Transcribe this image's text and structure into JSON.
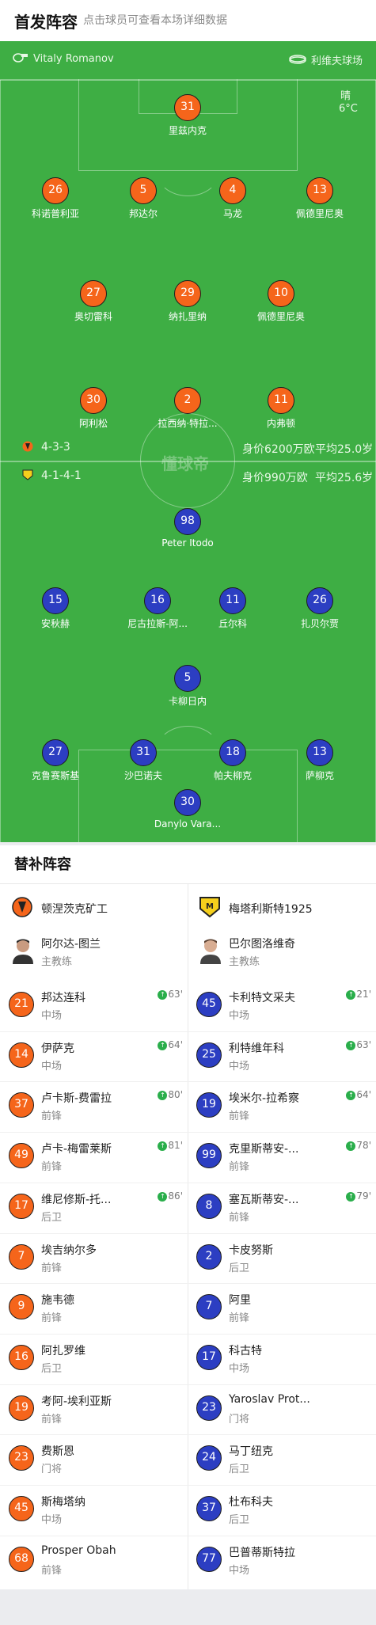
{
  "header": {
    "title": "首发阵容",
    "subtitle": "点击球员可查看本场详细数据"
  },
  "match": {
    "referee": "Vitaly Romanov",
    "stadium": "利维夫球场",
    "weather": "晴",
    "temperature": "6°C",
    "watermark": "懂球帝"
  },
  "home": {
    "formation": "4-3-3",
    "value": "身价6200万欧",
    "age": "平均25.0岁"
  },
  "away": {
    "formation": "4-1-4-1",
    "value": "身价990万欧",
    "age": "平均25.6岁"
  },
  "home_players": [
    {
      "num": "31",
      "name": "里兹内克"
    },
    {
      "num": "26",
      "name": "科诺普利亚"
    },
    {
      "num": "5",
      "name": "邦达尔",
      "card": "yellow",
      "captain": true
    },
    {
      "num": "4",
      "name": "马龙",
      "card": "yellow"
    },
    {
      "num": "13",
      "name": "佩德里尼奥"
    },
    {
      "num": "27",
      "name": "奥切雷科",
      "card": "yellow"
    },
    {
      "num": "29",
      "name": "纳扎里纳",
      "sub_out": "63'"
    },
    {
      "num": "10",
      "name": "佩德里尼奥",
      "sub_out": "64'",
      "goal": true
    },
    {
      "num": "30",
      "name": "阿利松",
      "sub_out": "86'"
    },
    {
      "num": "2",
      "name": "拉西纳·特拉...",
      "sub_out": "81'"
    },
    {
      "num": "11",
      "name": "内弗顿",
      "sub_out": "80'"
    }
  ],
  "away_players": [
    {
      "num": "98",
      "name": "Peter Itodo",
      "sub_out": "78'"
    },
    {
      "num": "15",
      "name": "安秋赫",
      "sub_out": "79'"
    },
    {
      "num": "16",
      "name": "尼古拉斯-阿...",
      "sub_out": "63'"
    },
    {
      "num": "11",
      "name": "丘尔科",
      "sub_out": "21'"
    },
    {
      "num": "26",
      "name": "扎贝尔贾",
      "sub_out": "64'"
    },
    {
      "num": "5",
      "name": "卡柳日内",
      "card": "yellow",
      "captain": true
    },
    {
      "num": "27",
      "name": "克鲁赛斯基"
    },
    {
      "num": "31",
      "name": "沙巴诺夫",
      "card": "yellow"
    },
    {
      "num": "18",
      "name": "帕夫柳克"
    },
    {
      "num": "13",
      "name": "萨柳克",
      "card": "yellow"
    },
    {
      "num": "30",
      "name": "Danylo Vara...",
      "card": "yellow"
    }
  ],
  "subs": {
    "title": "替补阵容",
    "home_team": "顿涅茨克矿工",
    "away_team": "梅塔利斯特1925",
    "home_coach": {
      "name": "阿尔达-图兰",
      "role": "主教练"
    },
    "away_coach": {
      "name": "巴尔图洛维奇",
      "role": "主教练"
    },
    "home": [
      {
        "num": "21",
        "name": "邦达连科",
        "pos": "中场",
        "sub": "63'"
      },
      {
        "num": "14",
        "name": "伊萨克",
        "pos": "中场",
        "sub": "64'"
      },
      {
        "num": "37",
        "name": "卢卡斯-费雷拉",
        "pos": "前锋",
        "sub": "80'"
      },
      {
        "num": "49",
        "name": "卢卡-梅雷莱斯",
        "pos": "前锋",
        "sub": "81'"
      },
      {
        "num": "17",
        "name": "维尼修斯-托...",
        "pos": "后卫",
        "sub": "86'"
      },
      {
        "num": "7",
        "name": "埃吉纳尔多",
        "pos": "前锋"
      },
      {
        "num": "9",
        "name": "施韦德",
        "pos": "前锋"
      },
      {
        "num": "16",
        "name": "阿扎罗维",
        "pos": "后卫"
      },
      {
        "num": "19",
        "name": "考阿-埃利亚斯",
        "pos": "前锋"
      },
      {
        "num": "23",
        "name": "费斯恩",
        "pos": "门将"
      },
      {
        "num": "45",
        "name": "斯梅塔纳",
        "pos": "中场"
      },
      {
        "num": "68",
        "name": "Prosper Obah",
        "pos": "前锋"
      }
    ],
    "away": [
      {
        "num": "45",
        "name": "卡利特文采夫",
        "pos": "中场",
        "sub": "21'"
      },
      {
        "num": "25",
        "name": "利特维年科",
        "pos": "中场",
        "sub": "63'"
      },
      {
        "num": "19",
        "name": "埃米尔-拉希察",
        "pos": "前锋",
        "sub": "64'"
      },
      {
        "num": "99",
        "name": "克里斯蒂安-...",
        "pos": "前锋",
        "sub": "78'"
      },
      {
        "num": "8",
        "name": "塞瓦斯蒂安-...",
        "pos": "前锋",
        "sub": "79'"
      },
      {
        "num": "2",
        "name": "卡皮努斯",
        "pos": "后卫"
      },
      {
        "num": "7",
        "name": "阿里",
        "pos": "前锋"
      },
      {
        "num": "17",
        "name": "科古特",
        "pos": "中场"
      },
      {
        "num": "23",
        "name": "Yaroslav Prot...",
        "pos": "门将"
      },
      {
        "num": "24",
        "name": "马丁纽克",
        "pos": "后卫"
      },
      {
        "num": "37",
        "name": "杜布科夫",
        "pos": "后卫"
      },
      {
        "num": "77",
        "name": "巴普蒂斯特拉",
        "pos": "中场"
      }
    ]
  },
  "colors": {
    "pitch": "#3eae44",
    "home": "#f5651b",
    "away": "#2c3ec2",
    "card": "#f5cf1c"
  },
  "icons": {
    "referee": "whistle-icon",
    "stadium": "stadium-icon",
    "sub": "substitution-icon",
    "captain": "captain-icon",
    "goal": "football-icon"
  }
}
